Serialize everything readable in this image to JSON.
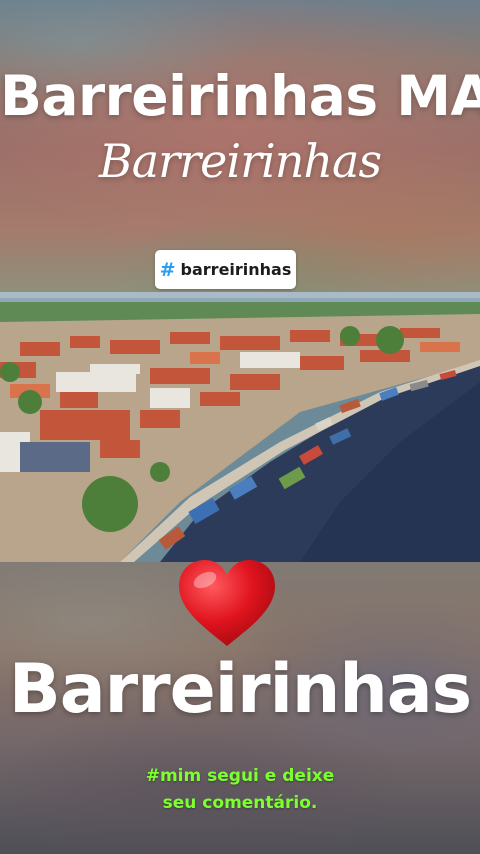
{
  "story": {
    "title": "Barreirinhas MA",
    "script_title": "Barreirinhas",
    "hashtag_chip": {
      "hash": "#",
      "tag": "barreirinhas"
    },
    "photo": {
      "description_icon": "aerial-photo"
    },
    "heart": {
      "icon": "heart-icon",
      "color": "#e0141e"
    },
    "big_title": "Barreirinhas",
    "caption_line1": "#mim segui e deixe",
    "caption_line2": "seu comentário."
  },
  "colors": {
    "caption": "#7cff2e",
    "hashtag_blue": "#2a9df4",
    "water": "#2c3b5a"
  }
}
